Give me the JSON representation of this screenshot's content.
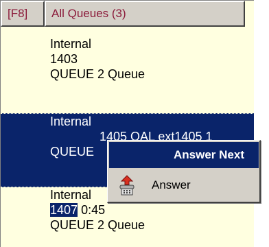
{
  "header": {
    "hotkey_label": "[F8]",
    "queue_label": "All Queues (3)"
  },
  "calls": [
    {
      "line1": "Internal",
      "line2": "1403",
      "line3": "QUEUE 2 Queue",
      "selected": false
    },
    {
      "line1": "Internal",
      "line2a": "14",
      "line2b": "05 OAL ext1405 1",
      "line3": "QUEUE",
      "selected": true
    },
    {
      "line1": "Internal",
      "line2_ext": "1407",
      "line2_time": "0:45",
      "line3": "QUEUE 2 Queue",
      "selected": false
    }
  ],
  "context_menu": {
    "items": [
      {
        "label": "Answer Next",
        "icon": ""
      },
      {
        "label": "Answer",
        "icon": "phone-answer-icon"
      }
    ]
  },
  "colors": {
    "panel_bg": "#ffffe0",
    "selection": "#0a246a",
    "header_text": "#8b1a3a",
    "menu_bg": "#d4d0c8"
  }
}
